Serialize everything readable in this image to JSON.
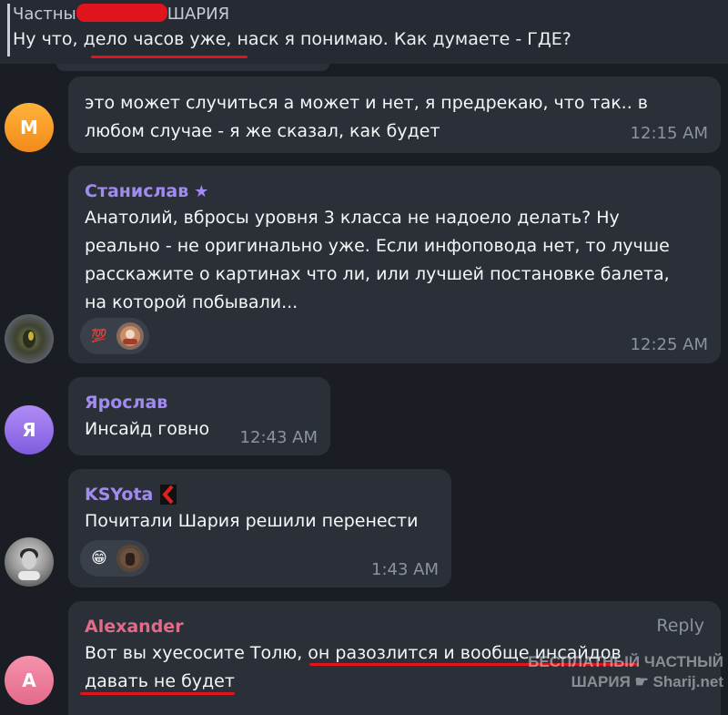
{
  "header": {
    "sender_prefix": "Частны",
    "sender_suffix": "ШАРИЯ",
    "quote_text": "Ну что, дело часов уже, наск я понимаю. Как думаете - ГДЕ?"
  },
  "messages": [
    {
      "id": "m1",
      "avatar_letter": "M",
      "text": "это может случиться а может и нет, я предрекаю, что так.. в любом случае - я же сказал, как будет",
      "time": "12:15 AM"
    },
    {
      "id": "m2",
      "sender": "Станислав",
      "text": "Анатолий, вбросы уровня 3 класса не надоело делать? Ну реально - не оригинально уже. Если инфоповода нет, то лучше расскажите о картинах что ли, или лучшей постановке балета, на которой побывали...",
      "reaction_1": "💯",
      "time": "12:25 AM"
    },
    {
      "id": "m3",
      "avatar_letter": "Я",
      "sender": "Ярослав",
      "text": "Инсайд говно",
      "time": "12:43 AM"
    },
    {
      "id": "m4",
      "sender": "KSYota",
      "text": "Почитали Шария решили перенести",
      "reaction_1": "😁",
      "time": "1:43 AM"
    },
    {
      "id": "m5",
      "avatar_letter": "A",
      "sender": "Alexander",
      "reply_label": "Reply",
      "text": "Вот вы хуесосите Толю, он разозлится и вообще инсайдов давать не будет"
    }
  ],
  "watermark": {
    "line1": "БЕСПЛАТНЫЙ ЧАСТНЫЙ",
    "line2": "ШАРИЯ",
    "site": "Sharij.net"
  },
  "colors": {
    "background": "#1a1e24",
    "bubble": "#2b3038",
    "accent_purple": "#a28bf0",
    "accent_pink": "#e26b8a",
    "highlight_red": "#e0141c"
  }
}
